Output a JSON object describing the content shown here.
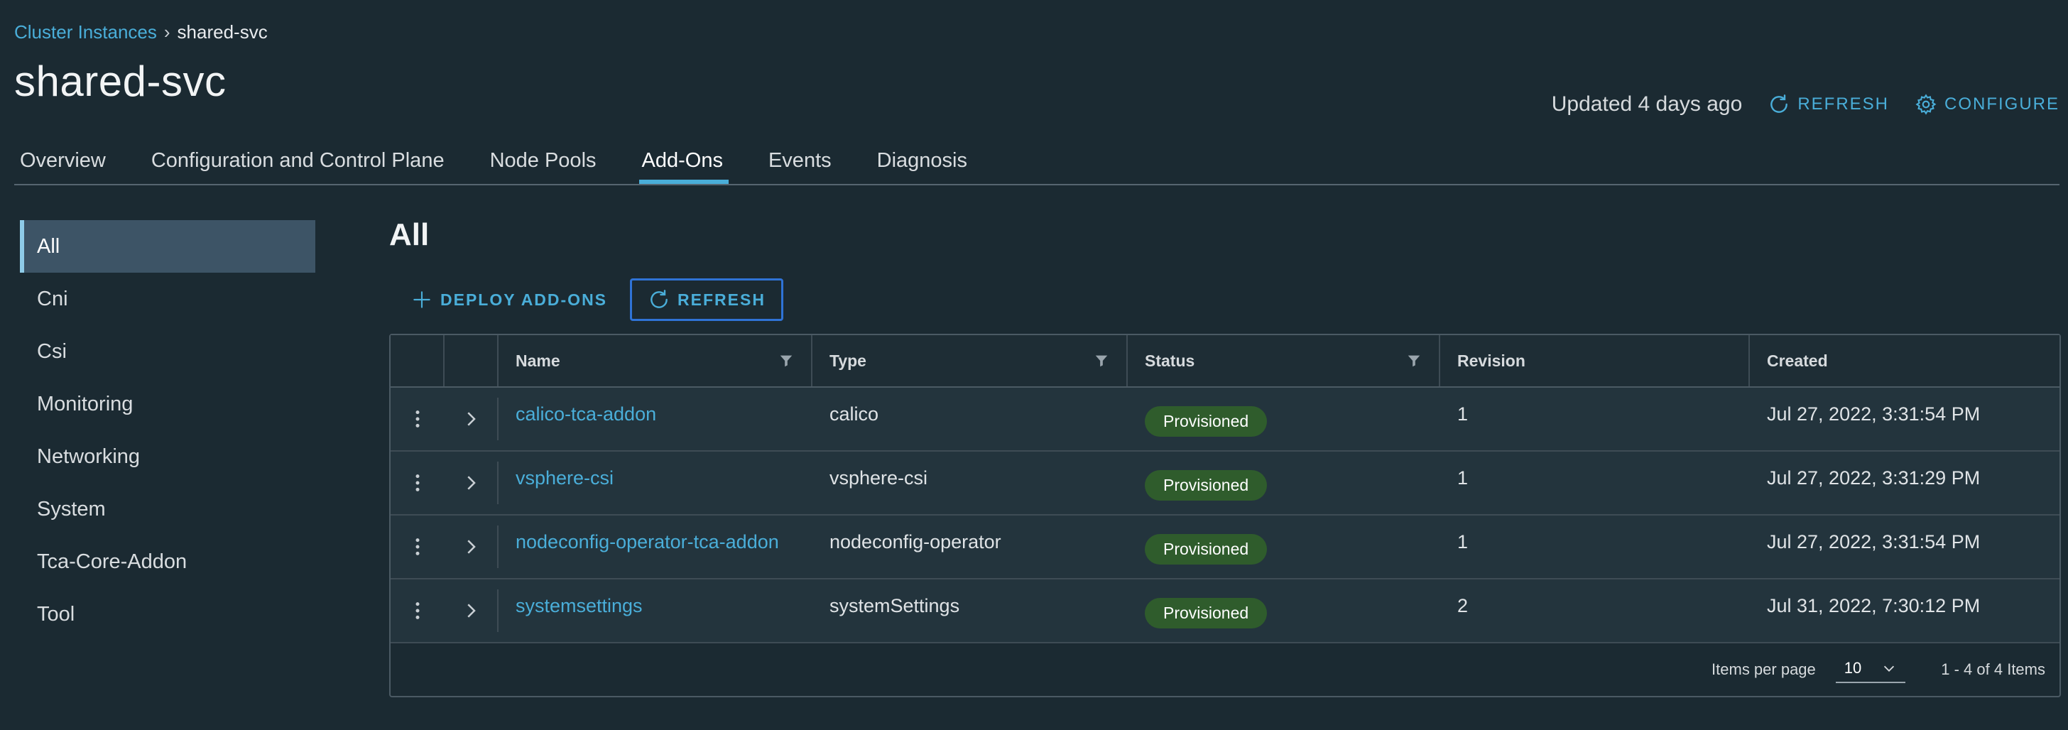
{
  "breadcrumb": {
    "parent": "Cluster Instances",
    "current": "shared-svc"
  },
  "page_title": "shared-svc",
  "header": {
    "updated": "Updated 4 days ago",
    "refresh_label": "REFRESH",
    "configure_label": "CONFIGURE"
  },
  "tabs": [
    {
      "label": "Overview"
    },
    {
      "label": "Configuration and Control Plane"
    },
    {
      "label": "Node Pools"
    },
    {
      "label": "Add-Ons"
    },
    {
      "label": "Events"
    },
    {
      "label": "Diagnosis"
    }
  ],
  "sidebar": {
    "items": [
      {
        "label": "All"
      },
      {
        "label": "Cni"
      },
      {
        "label": "Csi"
      },
      {
        "label": "Monitoring"
      },
      {
        "label": "Networking"
      },
      {
        "label": "System"
      },
      {
        "label": "Tca-Core-Addon"
      },
      {
        "label": "Tool"
      }
    ]
  },
  "main": {
    "title": "All",
    "deploy_label": "DEPLOY ADD-ONS",
    "refresh_label": "REFRESH"
  },
  "grid": {
    "columns": {
      "name": "Name",
      "type": "Type",
      "status": "Status",
      "revision": "Revision",
      "created": "Created"
    },
    "rows": [
      {
        "name": "calico-tca-addon",
        "type": "calico",
        "status": "Provisioned",
        "revision": "1",
        "created": "Jul 27, 2022, 3:31:54 PM"
      },
      {
        "name": "vsphere-csi",
        "type": "vsphere-csi",
        "status": "Provisioned",
        "revision": "1",
        "created": "Jul 27, 2022, 3:31:29 PM"
      },
      {
        "name": "nodeconfig-operator-tca-addon",
        "type": "nodeconfig-operator",
        "status": "Provisioned",
        "revision": "1",
        "created": "Jul 27, 2022, 3:31:54 PM"
      },
      {
        "name": "systemsettings",
        "type": "systemSettings",
        "status": "Provisioned",
        "revision": "2",
        "created": "Jul 31, 2022, 7:30:12 PM"
      }
    ],
    "footer": {
      "items_per_page_label": "Items per page",
      "items_per_page": "10",
      "range": "1 - 4 of 4 Items"
    }
  },
  "colors": {
    "accent": "#4aaed9",
    "badge_green": "#2f5c2c",
    "background": "#1b2a32"
  }
}
